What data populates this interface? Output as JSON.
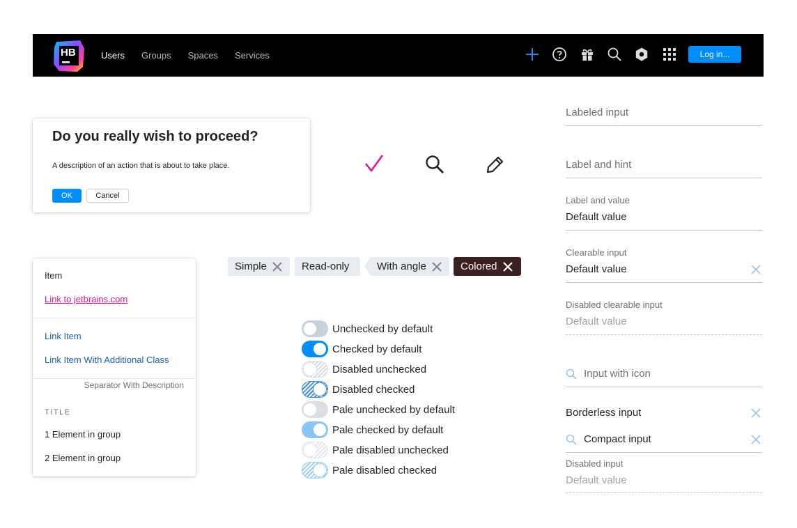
{
  "header": {
    "logo_text": "HB",
    "nav": [
      "Users",
      "Groups",
      "Spaces",
      "Services"
    ],
    "active_nav": "Users",
    "icons": [
      "add-icon",
      "help-icon",
      "gift-icon",
      "search-icon",
      "settings-icon",
      "apps-grid-icon"
    ],
    "login_label": "Log in...",
    "accent": "#008eff"
  },
  "dialog": {
    "title": "Do you really wish to proceed?",
    "description": "A description of an action that is about to take place.",
    "ok_label": "OK",
    "cancel_label": "Cancel"
  },
  "standalone_icons": [
    "checkmark-icon",
    "search-icon",
    "pencil-icon"
  ],
  "dropdown": {
    "item": "Item",
    "link_pink": "Link to jetbrains.com",
    "link_item": "Link Item",
    "link_item_class": "Link Item With Additional Class",
    "separator_desc": "Separator With Description",
    "title": "TITLE",
    "group_items": [
      "1 Element in group",
      "2 Element in group"
    ]
  },
  "tags": {
    "simple": "Simple",
    "readonly": "Read-only",
    "angle": "With angle",
    "colored": "Colored",
    "colored_bg": "#3c2020"
  },
  "toggles": [
    {
      "label": "Unchecked by default",
      "checked": false,
      "disabled": false,
      "pale": false
    },
    {
      "label": "Checked by default",
      "checked": true,
      "disabled": false,
      "pale": false
    },
    {
      "label": "Disabled unchecked",
      "checked": false,
      "disabled": true,
      "pale": false
    },
    {
      "label": "Disabled checked",
      "checked": true,
      "disabled": true,
      "pale": false
    },
    {
      "label": "Pale unchecked by default",
      "checked": false,
      "disabled": false,
      "pale": true
    },
    {
      "label": "Pale checked by default",
      "checked": true,
      "disabled": false,
      "pale": true
    },
    {
      "label": "Pale disabled unchecked",
      "checked": false,
      "disabled": true,
      "pale": true
    },
    {
      "label": "Pale disabled checked",
      "checked": true,
      "disabled": true,
      "pale": true
    }
  ],
  "inputs": {
    "labeled_placeholder": "Labeled input",
    "label_hint_placeholder": "Label and hint",
    "label_value_label": "Label and value",
    "label_value_value": "Default value",
    "clearable_label": "Clearable input",
    "clearable_value": "Default value",
    "disabled_clearable_label": "Disabled clearable input",
    "disabled_clearable_value": "Default value",
    "icon_placeholder": "Input with icon",
    "borderless_value": "Borderless input",
    "compact_value": "Compact input",
    "disabled_label": "Disabled input",
    "disabled_value": "Default value"
  }
}
